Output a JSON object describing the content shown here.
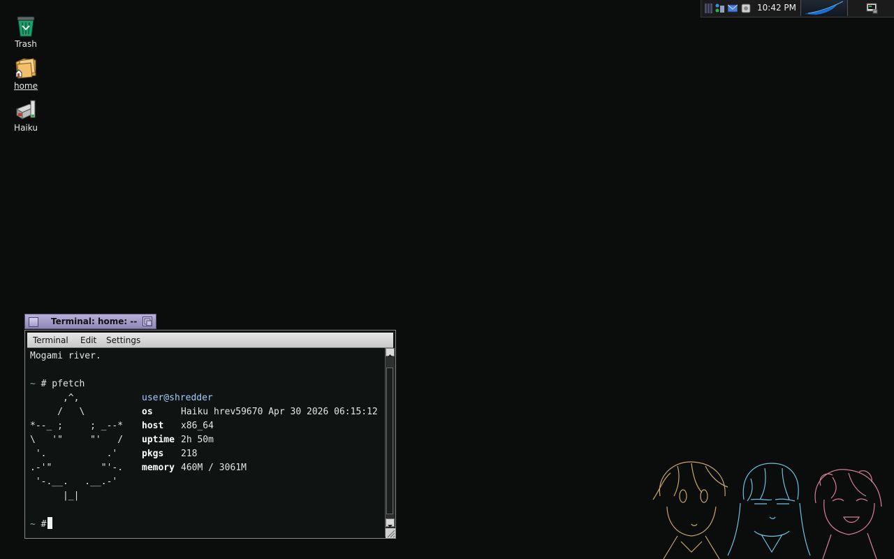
{
  "desktop": {
    "icons": [
      {
        "label": "Trash",
        "icon": "trash-icon"
      },
      {
        "label": "home",
        "icon": "home-folder-icon"
      },
      {
        "label": "Haiku",
        "icon": "haiku-disk-icon"
      }
    ]
  },
  "deskbar": {
    "clock": "10:42 PM",
    "tray_icons": [
      "cpu-monitor-icon",
      "network-icon",
      "power-icon",
      "mail-icon",
      "drive-icon"
    ]
  },
  "terminal": {
    "window_title": "Terminal: home: --",
    "menu": [
      "Terminal",
      "Edit",
      "Settings"
    ],
    "lines": {
      "l0": "Mogami river.",
      "prompt1_sym": "~",
      "prompt1_cmd": " # pfetch",
      "art0": "      ,^,",
      "art1": "     /   \\",
      "art2": "*--_ ;     ; _--*",
      "art3": "\\   '\"     \"'   /",
      "art4": " '.           .'",
      "art5": ".-'\"         \"'-.",
      "art6": " '-.__.   .__.-'",
      "art7": "      |_|",
      "userhost": "user@shredder",
      "os_label": "os",
      "os_value": "Haiku hrev59670 Apr 30 2026 06:15:12",
      "host_label": "host",
      "host_value": "x86_64",
      "uptime_label": "uptime",
      "uptime_value": "2h 50m",
      "pkgs_label": "pkgs",
      "pkgs_value": "218",
      "memory_label": "memory",
      "memory_value": "460M / 3061M",
      "prompt2_sym": "~",
      "prompt2_cmd": " #"
    }
  },
  "colors": {
    "desktop_bg": "#0a0d0c",
    "tab_accent": "#b9b0da",
    "userhost": "#a9c8ff"
  }
}
